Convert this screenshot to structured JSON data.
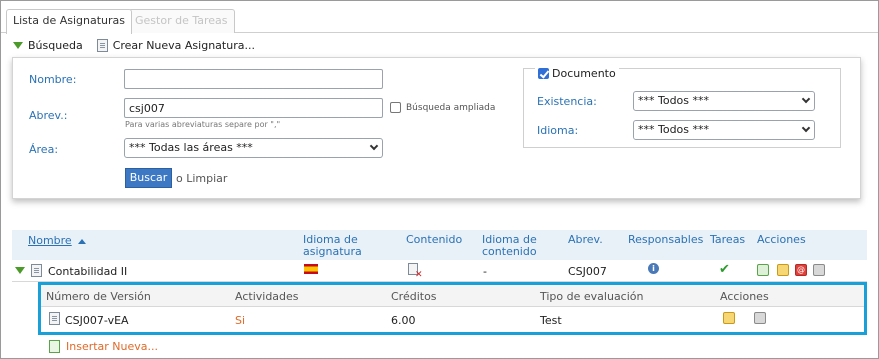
{
  "tabs": [
    {
      "label": "Lista de Asignaturas",
      "active": true
    },
    {
      "label": "Gestor de Tareas",
      "active": false
    }
  ],
  "toolbar": {
    "search_label": "Búsqueda",
    "create_label": "Crear Nueva Asignatura..."
  },
  "search": {
    "nombre_label": "Nombre:",
    "nombre_value": "",
    "abrev_label": "Abrev.:",
    "abrev_value": "csj007",
    "abrev_hint": "Para varias abreviaturas separe por \",\"",
    "extended_label": "Búsqueda ampliada",
    "extended_checked": false,
    "area_label": "Área:",
    "area_value": "*** Todas las áreas ***",
    "document_label": "Documento",
    "document_checked": true,
    "existencia_label": "Existencia:",
    "existencia_value": "*** Todos ***",
    "idioma_label": "Idioma:",
    "idioma_value": "*** Todos ***",
    "search_button": "Buscar",
    "or_text": "o",
    "clear_link": "Limpiar"
  },
  "table": {
    "headers": {
      "nombre": "Nombre",
      "idioma_asig_1": "Idioma de",
      "idioma_asig_2": "asignatura",
      "contenido": "Contenido",
      "idioma_cont_1": "Idioma de",
      "idioma_cont_2": "contenido",
      "abrev": "Abrev.",
      "responsables": "Responsables",
      "tareas": "Tareas",
      "acciones": "Acciones"
    },
    "rows": [
      {
        "name": "Contabilidad II",
        "idioma_contenido": "-",
        "abrev": "CSJ007"
      }
    ]
  },
  "versions": {
    "headers": {
      "numero": "Número de Versión",
      "actividades": "Actividades",
      "creditos": "Créditos",
      "tipo": "Tipo de evaluación",
      "acciones": "Acciones"
    },
    "rows": [
      {
        "numero": "CSJ007-vEA",
        "actividades": "Si",
        "creditos": "6.00",
        "tipo": "Test"
      }
    ]
  },
  "insert_link": "Insertar Nueva...",
  "colors": {
    "label_blue": "#2a72b5",
    "accent_orange": "#e06a2a",
    "highlight_border": "#1aa0d8",
    "header_bg": "#e9f1f8"
  }
}
